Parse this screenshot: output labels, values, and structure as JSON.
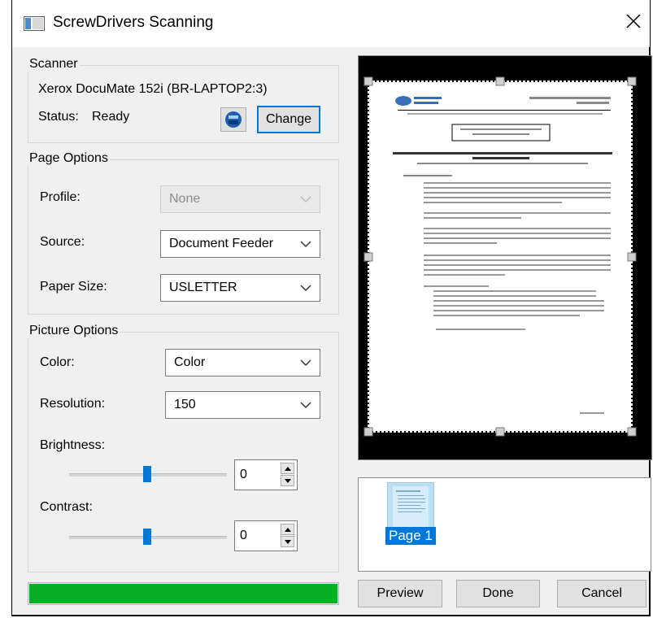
{
  "window": {
    "title": "ScrewDrivers Scanning"
  },
  "scanner": {
    "group_label": "Scanner",
    "device_name": "Xerox DocuMate 152i (BR-LAPTOP2:3)",
    "status_label": "Status:",
    "status_value": "Ready",
    "change_label": "Change"
  },
  "page_options": {
    "group_label": "Page Options",
    "profile_label": "Profile:",
    "profile_value": "None",
    "source_label": "Source:",
    "source_value": "Document Feeder",
    "paper_size_label": "Paper Size:",
    "paper_size_value": "USLETTER"
  },
  "picture_options": {
    "group_label": "Picture Options",
    "color_label": "Color:",
    "color_value": "Color",
    "resolution_label": "Resolution:",
    "resolution_value": "150",
    "brightness_label": "Brightness:",
    "brightness_value": "0",
    "contrast_label": "Contrast:",
    "contrast_value": "0"
  },
  "progress": {
    "fraction": 1.0,
    "color": "#06b025"
  },
  "thumbnails": [
    {
      "label": "Page 1"
    }
  ],
  "buttons": {
    "preview": "Preview",
    "done": "Done",
    "cancel": "Cancel"
  },
  "colors": {
    "accent": "#0078d7",
    "progress": "#06b025",
    "thumb": "#bcdff5"
  }
}
